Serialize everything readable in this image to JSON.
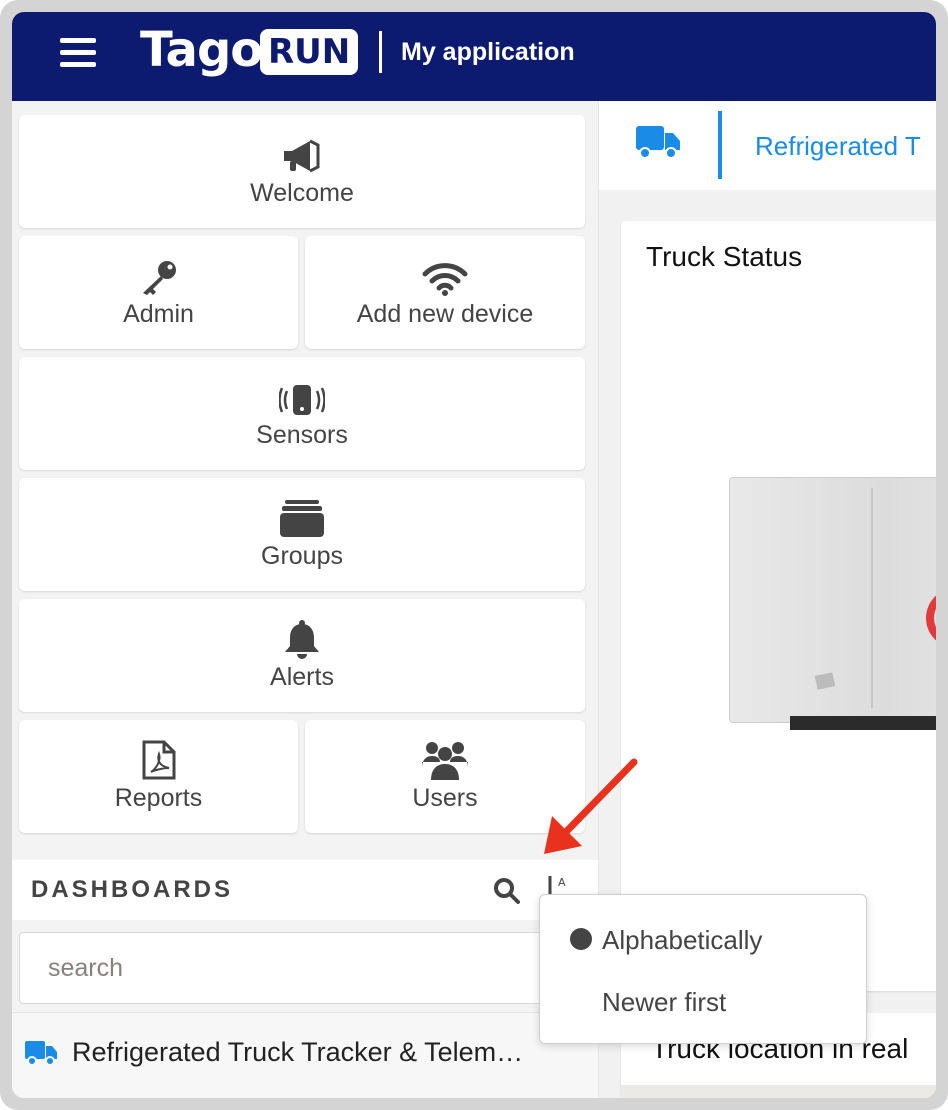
{
  "header": {
    "logo_text": "Tago",
    "logo_badge": "RUN",
    "app_title": "My application",
    "bg_color": "#0c1a70"
  },
  "sidebar": {
    "tiles": [
      {
        "label": "Welcome",
        "icon": "megaphone-icon"
      },
      {
        "label": "Admin",
        "icon": "key-icon"
      },
      {
        "label": "Add new device",
        "icon": "wifi-icon"
      },
      {
        "label": "Sensors",
        "icon": "vibrating-phone-icon"
      },
      {
        "label": "Groups",
        "icon": "folders-stack-icon"
      },
      {
        "label": "Alerts",
        "icon": "bell-icon"
      },
      {
        "label": "Reports",
        "icon": "pdf-file-icon"
      },
      {
        "label": "Users",
        "icon": "users-group-icon"
      }
    ],
    "dashboards_heading": "DASHBOARDS",
    "search_placeholder": "search",
    "dashboard_items": [
      {
        "label": "Refrigerated Truck Tracker & Telem…",
        "icon": "truck-icon"
      }
    ]
  },
  "sort_menu": {
    "options": [
      {
        "label": "Alphabetically",
        "selected": true
      },
      {
        "label": "Newer first",
        "selected": false
      }
    ]
  },
  "main": {
    "tab_title": "Refrigerated T",
    "tab_icon": "truck-icon",
    "accent_color": "#1a8ce8",
    "widgets": [
      {
        "title": "Truck Status"
      },
      {
        "title": "Truck location in real"
      }
    ]
  },
  "annotation": {
    "arrow_color": "#e8321e"
  }
}
